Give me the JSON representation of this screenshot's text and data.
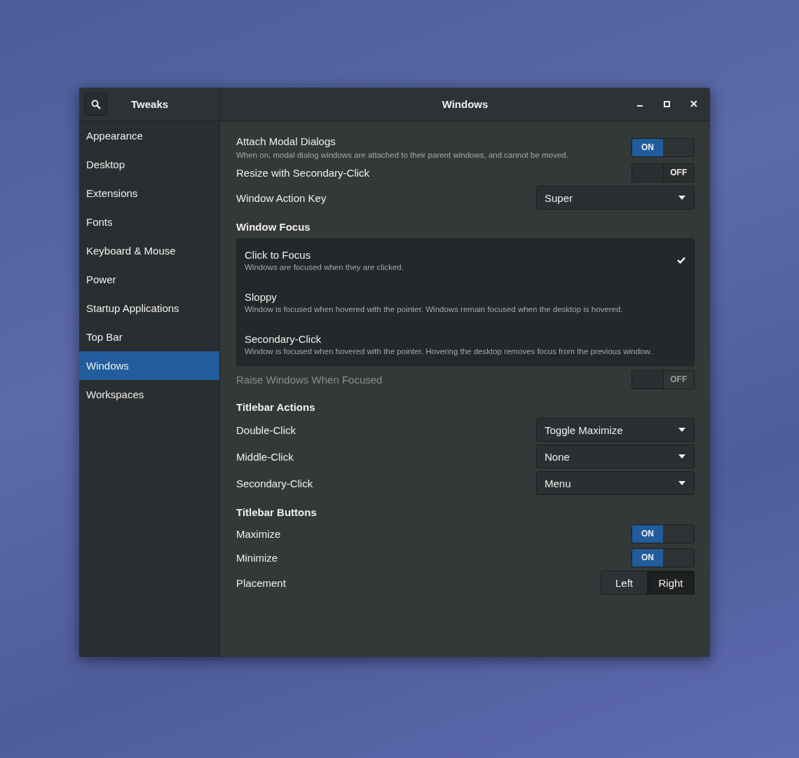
{
  "window": {
    "app_title": "Tweaks",
    "page_title": "Windows"
  },
  "sidebar": {
    "items": [
      {
        "label": "Appearance",
        "selected": false
      },
      {
        "label": "Desktop",
        "selected": false
      },
      {
        "label": "Extensions",
        "selected": false
      },
      {
        "label": "Fonts",
        "selected": false
      },
      {
        "label": "Keyboard & Mouse",
        "selected": false
      },
      {
        "label": "Power",
        "selected": false
      },
      {
        "label": "Startup Applications",
        "selected": false
      },
      {
        "label": "Top Bar",
        "selected": false
      },
      {
        "label": "Windows",
        "selected": true
      },
      {
        "label": "Workspaces",
        "selected": false
      }
    ]
  },
  "content": {
    "rows": [
      {
        "kind": "switch",
        "label": "Attach Modal Dialogs",
        "description": "When on, modal dialog windows are attached to their parent windows, and cannot be moved.",
        "on": true,
        "text": "ON",
        "disabled": false
      },
      {
        "kind": "switch",
        "label": "Resize with Secondary-Click",
        "on": false,
        "text": "OFF",
        "disabled": false
      },
      {
        "kind": "dropdown",
        "label": "Window Action Key",
        "value": "Super"
      },
      {
        "kind": "heading",
        "label": "Window Focus"
      },
      {
        "kind": "radio-list",
        "options": [
          {
            "title": "Click to Focus",
            "description": "Windows are focused when they are clicked.",
            "selected": true
          },
          {
            "title": "Sloppy",
            "description": "Window is focused when hovered with the pointer. Windows remain focused when the desktop is hovered.",
            "selected": false
          },
          {
            "title": "Secondary-Click",
            "description": "Window is focused when hovered with the pointer. Hovering the desktop removes focus from the previous window.",
            "selected": false
          }
        ]
      },
      {
        "kind": "switch",
        "label": "Raise Windows When Focused",
        "on": false,
        "text": "OFF",
        "disabled": true
      },
      {
        "kind": "heading",
        "label": "Titlebar Actions"
      },
      {
        "kind": "dropdown",
        "label": "Double-Click",
        "value": "Toggle Maximize"
      },
      {
        "kind": "dropdown",
        "label": "Middle-Click",
        "value": "None"
      },
      {
        "kind": "dropdown",
        "label": "Secondary-Click",
        "value": "Menu"
      },
      {
        "kind": "heading",
        "label": "Titlebar Buttons"
      },
      {
        "kind": "switch",
        "label": "Maximize",
        "on": true,
        "text": "ON",
        "disabled": false
      },
      {
        "kind": "switch",
        "label": "Minimize",
        "on": true,
        "text": "ON",
        "disabled": false
      },
      {
        "kind": "segmented",
        "label": "Placement",
        "options": [
          {
            "label": "Left",
            "selected": false
          },
          {
            "label": "Right",
            "selected": true
          }
        ]
      }
    ]
  }
}
